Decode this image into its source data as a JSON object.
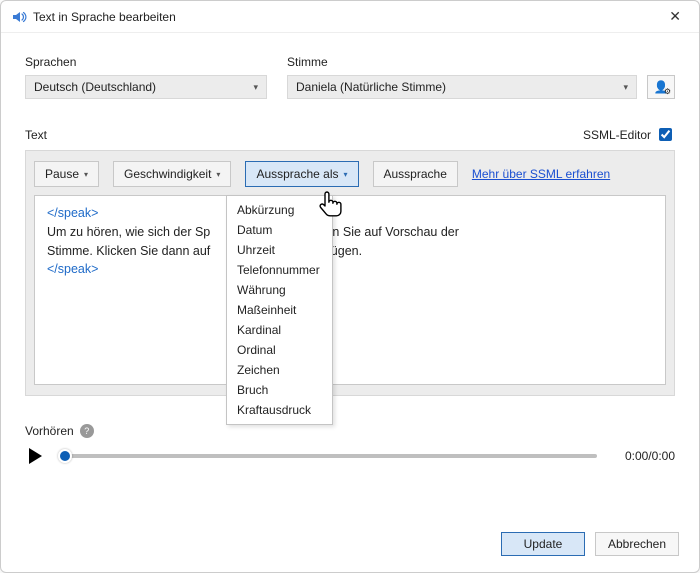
{
  "window": {
    "title": "Text in Sprache bearbeiten"
  },
  "labels": {
    "languages": "Sprachen",
    "voice": "Stimme",
    "text": "Text",
    "ssml_editor": "SSML-Editor",
    "preview": "Vorhören"
  },
  "language_select": {
    "value": "Deutsch (Deutschland)"
  },
  "voice_select": {
    "value": "Daniela (Natürliche Stimme)"
  },
  "toolbar": {
    "pause": "Pause",
    "speed": "Geschwindigkeit",
    "say_as": "Aussprache als",
    "pronunciation": "Aussprache",
    "ssml_link": "Mehr über SSML erfahren"
  },
  "say_as_menu": [
    "Abkürzung",
    "Datum",
    "Uhrzeit",
    "Telefonnummer",
    "Währung",
    "Maßeinheit",
    "Kardinal",
    "Ordinal",
    "Zeichen",
    "Bruch",
    "Kraftausdruck"
  ],
  "editor": {
    "tag_open": "</speak>",
    "line1a": "Um zu hören, wie sich der Sp",
    "line1b": "ken Sie auf Vorschau der",
    "line2a": "Stimme. Klicken Sie dann auf",
    "line2b": "Einfügen.",
    "tag_close": "</speak>"
  },
  "player": {
    "time": "0:00/0:00"
  },
  "footer": {
    "update": "Update",
    "cancel": "Abbrechen"
  },
  "ssml_checked": true
}
